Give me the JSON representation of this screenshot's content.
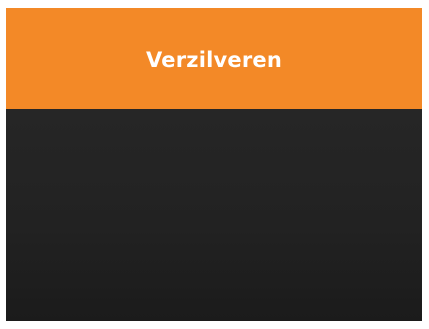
{
  "header": {
    "label": "Verzilveren",
    "background_color": "#f38927",
    "text_color": "#ffffff"
  },
  "content_panel": {
    "background_color": "#222222"
  }
}
